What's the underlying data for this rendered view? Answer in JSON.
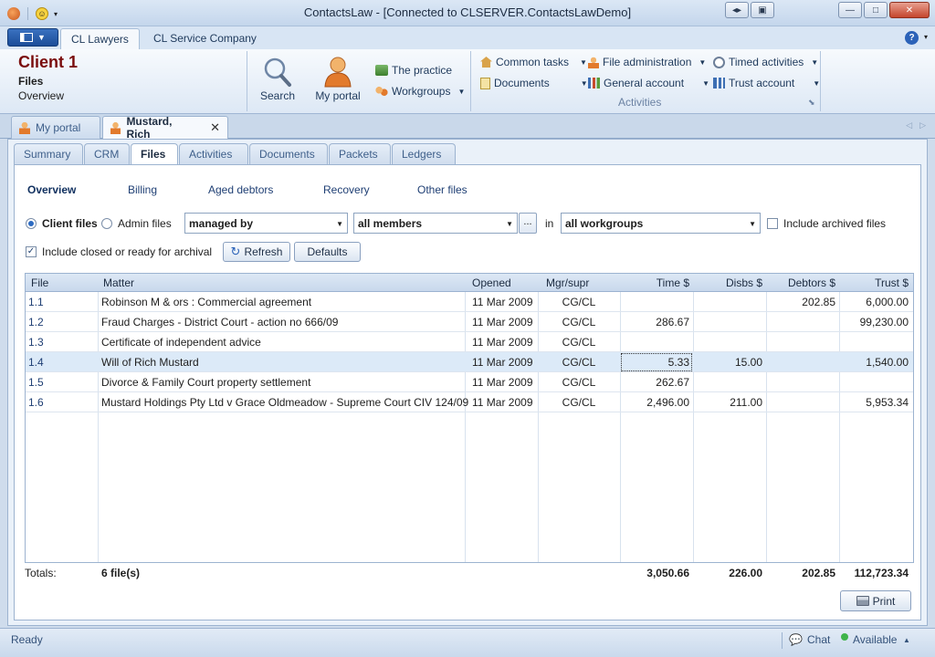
{
  "window": {
    "title": "ContactsLaw - [Connected to CLSERVER.ContactsLawDemo]"
  },
  "ribbon_tabs": [
    "CL Lawyers",
    "CL Service Company"
  ],
  "client": {
    "name": "Client 1",
    "section": "Files",
    "view": "Overview"
  },
  "ribbon": {
    "search_label": "Search",
    "portal_label": "My portal",
    "practice_label": "The practice",
    "workgroups_label": "Workgroups",
    "common_tasks": "Common tasks",
    "documents": "Documents",
    "file_admin": "File administration",
    "general_account": "General account",
    "timed_activities": "Timed activities",
    "trust_account": "Trust account",
    "group_label": "Activities"
  },
  "doc_tabs": {
    "portal": "My portal",
    "contact": "Mustard, Rich",
    "close": "✕"
  },
  "sub_tabs": [
    "Summary",
    "CRM",
    "Files",
    "Activities",
    "Documents",
    "Packets",
    "Ledgers"
  ],
  "view_links": [
    "Overview",
    "Billing",
    "Aged debtors",
    "Recovery",
    "Other files"
  ],
  "filters": {
    "client_files": "Client files",
    "admin_files": "Admin files",
    "managed_by": "managed by",
    "members": "all members",
    "ellipsis": "...",
    "in_label": "in",
    "workgroups": "all workgroups",
    "include_archived": "Include archived files",
    "include_closed": "Include closed or ready for archival",
    "refresh": "Refresh",
    "defaults": "Defaults"
  },
  "grid": {
    "headers": [
      "File",
      "Matter",
      "Opened",
      "Mgr/supr",
      "Time $",
      "Disbs $",
      "Debtors $",
      "Trust $"
    ],
    "rows": [
      {
        "file": "1.1",
        "matter": "Robinson M & ors : Commercial agreement",
        "opened": "11 Mar 2009",
        "mgr": "CG/CL",
        "time": "",
        "disbs": "",
        "debtors": "202.85",
        "trust": "6,000.00"
      },
      {
        "file": "1.2",
        "matter": "Fraud Charges - District Court - action no 666/09",
        "opened": "11 Mar 2009",
        "mgr": "CG/CL",
        "time": "286.67",
        "disbs": "",
        "debtors": "",
        "trust": "99,230.00"
      },
      {
        "file": "1.3",
        "matter": "Certificate of independent advice",
        "opened": "11 Mar 2009",
        "mgr": "CG/CL",
        "time": "",
        "disbs": "",
        "debtors": "",
        "trust": ""
      },
      {
        "file": "1.4",
        "matter": "Will of Rich Mustard",
        "opened": "11 Mar 2009",
        "mgr": "CG/CL",
        "time": "5.33",
        "disbs": "15.00",
        "debtors": "",
        "trust": "1,540.00"
      },
      {
        "file": "1.5",
        "matter": "Divorce & Family Court property settlement",
        "opened": "11 Mar 2009",
        "mgr": "CG/CL",
        "time": "262.67",
        "disbs": "",
        "debtors": "",
        "trust": ""
      },
      {
        "file": "1.6",
        "matter": "Mustard Holdings Pty Ltd v Grace Oldmeadow - Supreme Court CIV 124/09",
        "opened": "11 Mar 2009",
        "mgr": "CG/CL",
        "time": "2,496.00",
        "disbs": "211.00",
        "debtors": "",
        "trust": "5,953.34"
      }
    ]
  },
  "totals": {
    "label": "Totals:",
    "files": "6 file(s)",
    "time": "3,050.66",
    "disbs": "226.00",
    "debtors": "202.85",
    "trust": "112,723.34"
  },
  "print_label": "Print",
  "status": {
    "left": "Ready",
    "chat": "Chat",
    "presence": "Available"
  }
}
